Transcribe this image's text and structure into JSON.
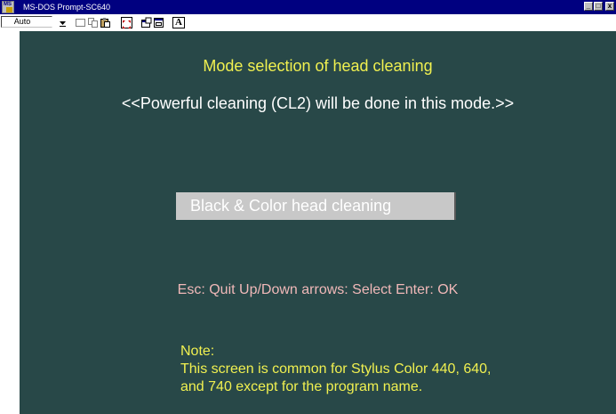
{
  "window": {
    "title": "MS-DOS Prompt-SC640",
    "controls": {
      "minimize": "_",
      "maximize": "□",
      "close": "x"
    }
  },
  "toolbar": {
    "font_size_value": "Auto",
    "icons": [
      "dropdown-arrow-icon",
      "mark-icon",
      "copy-icon",
      "paste-icon",
      "full-screen-icon",
      "properties-icon",
      "background-icon",
      "font-icon"
    ],
    "font_button_label": "A"
  },
  "screen": {
    "heading": "Mode selection of head cleaning",
    "subheading": "<<Powerful cleaning (CL2) will be done in this mode.>>",
    "options": [
      {
        "label": "Black & Color head cleaning",
        "selected": true
      }
    ],
    "help_line": "Esc: Quit  Up/Down arrows: Select  Enter: OK",
    "note": {
      "title": "Note:",
      "lines": [
        "This screen is common for Stylus Color 440, 640,",
        "and 740 except for the program name."
      ]
    }
  },
  "colors": {
    "titlebar": "#000080",
    "screen_background": "#284848",
    "heading_text": "#f0f050",
    "body_text": "#ffffff",
    "help_text": "#f0b8b8",
    "selection_bar": "#c8c8c8"
  }
}
